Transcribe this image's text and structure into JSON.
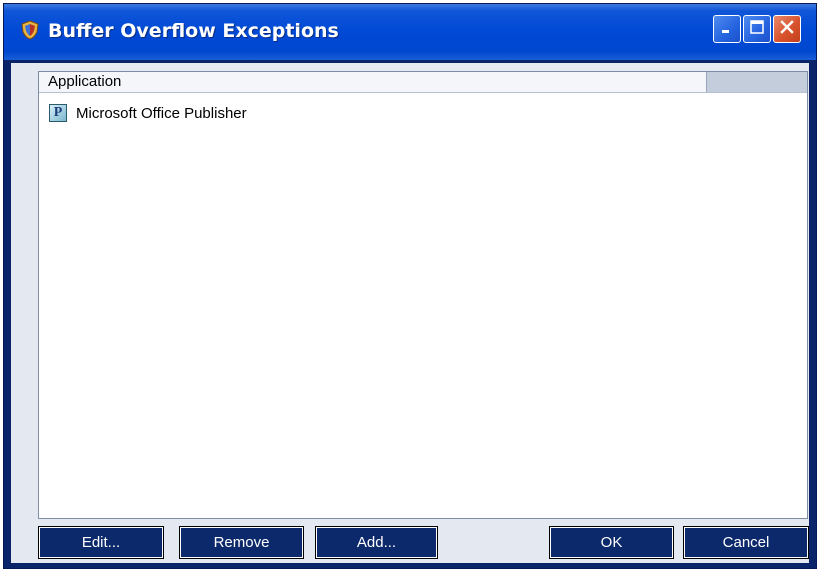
{
  "window": {
    "title": "Buffer Overflow Exceptions",
    "title_icon": "shield-app-icon",
    "controls": [
      "minimize-icon",
      "maximize-icon",
      "close-icon"
    ]
  },
  "list": {
    "columns": [
      "Application"
    ],
    "items": [
      {
        "label": "Microsoft Office Publisher",
        "icon": "publisher-icon"
      }
    ]
  },
  "buttons": {
    "edit": "Edit...",
    "remove": "Remove",
    "add": "Add...",
    "ok": "OK",
    "cancel": "Cancel"
  },
  "colors": {
    "titlebar": "#0049d6",
    "button_bg": "#0c2a6b",
    "client_bg": "#e4e9f1"
  }
}
